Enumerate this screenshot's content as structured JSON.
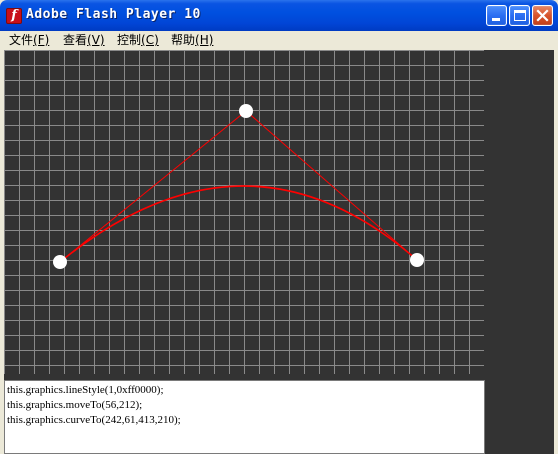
{
  "window": {
    "title": "Adobe Flash Player 10",
    "app_icon": "flash-player-icon",
    "app_icon_glyph": "f",
    "controls": [
      "minimize-icon",
      "maximize-icon",
      "close-icon"
    ]
  },
  "menu": {
    "items": [
      {
        "label": "文件",
        "key": "(F)"
      },
      {
        "label": "查看",
        "key": "(V)"
      },
      {
        "label": "控制",
        "key": "(C)"
      },
      {
        "label": "帮助",
        "key": "(H)"
      }
    ]
  },
  "colors": {
    "background": "#333333",
    "grid": "#8a8a8a",
    "curve": "#ff0000",
    "handle": "#ffffff"
  },
  "console": {
    "lines": [
      "this.graphics.lineStyle(1,0xff0000);",
      "this.graphics.moveTo(56,212);",
      "this.graphics.curveTo(242,61,413,210);"
    ]
  }
}
